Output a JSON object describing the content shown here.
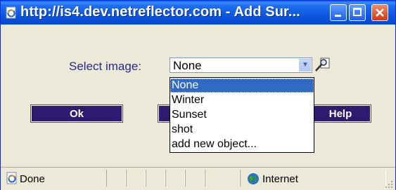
{
  "window": {
    "title": "http://is4.dev.netreflector.com - Add Sur..."
  },
  "form": {
    "select_label": "Select image:",
    "select_value": "None",
    "options": [
      "None",
      "Winter",
      "Sunset",
      "shot",
      "add new object..."
    ]
  },
  "buttons": {
    "ok_label": "Ok",
    "help_label": "Help"
  },
  "status": {
    "text": "Done",
    "zone": "Internet"
  },
  "icons": {
    "title": "ie-page-icon",
    "zoom": "magnifier-icon",
    "status": "ie-page-icon",
    "zone": "globe-icon"
  },
  "colors": {
    "titlebar": "#0a52de",
    "button_bg": "#2e1a6e",
    "selection": "#316ac5",
    "close_button": "#cd3a14"
  }
}
